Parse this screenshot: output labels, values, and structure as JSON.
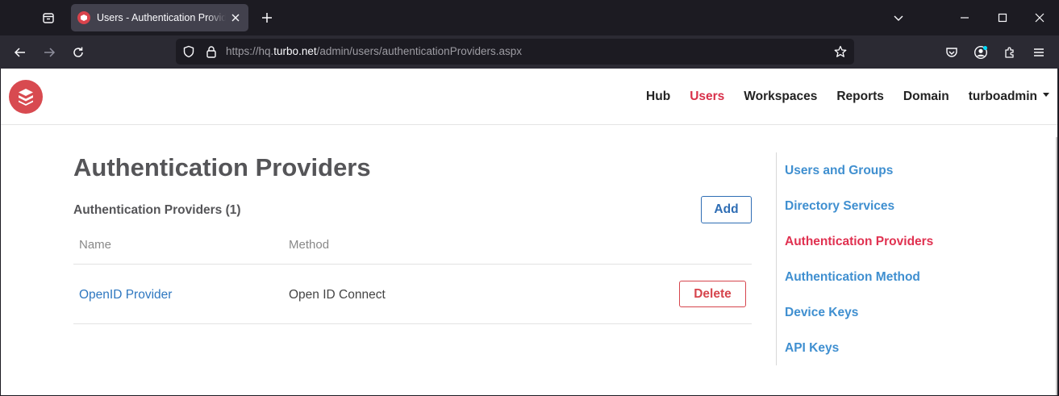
{
  "browser": {
    "tab_title": "Users - Authentication Providers",
    "url_prefix": "https://hq.",
    "url_domain": "turbo.net",
    "url_path": "/admin/users/authenticationProviders.aspx"
  },
  "header": {
    "nav": [
      "Hub",
      "Users",
      "Workspaces",
      "Reports",
      "Domain"
    ],
    "active_nav": "Users",
    "user_menu": "turboadmin"
  },
  "main": {
    "title": "Authentication Providers",
    "section_title": "Authentication Providers (1)",
    "add_label": "Add",
    "columns": [
      "Name",
      "Method"
    ],
    "rows": [
      {
        "name": "OpenID Provider",
        "method": "Open ID Connect",
        "action": "Delete"
      }
    ]
  },
  "sidebar": {
    "items": [
      {
        "label": "Users and Groups"
      },
      {
        "label": "Directory Services"
      },
      {
        "label": "Authentication Providers"
      },
      {
        "label": "Authentication Method"
      },
      {
        "label": "Device Keys"
      },
      {
        "label": "API Keys"
      }
    ],
    "active_index": 2
  },
  "colors": {
    "brand_red": "#d84a50",
    "active_nav": "#d8304a",
    "link_blue": "#3f8fd0",
    "add_blue": "#2e6db4",
    "delete_red": "#d6454d"
  },
  "icons": {
    "tab_list": "tab-list-icon",
    "tab_close": "close-icon",
    "new_tab": "plus-icon",
    "back": "back-arrow-icon",
    "forward": "forward-arrow-icon",
    "reload": "reload-icon",
    "shield": "shield-icon",
    "lock": "lock-icon",
    "bookmark": "star-icon",
    "pocket": "pocket-icon",
    "account": "account-icon",
    "extensions": "puzzle-icon",
    "menu": "hamburger-menu-icon"
  }
}
